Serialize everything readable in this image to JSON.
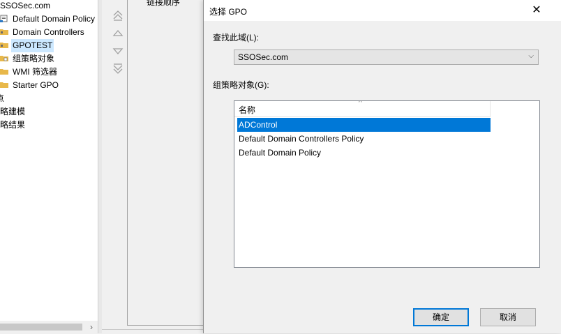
{
  "tree": {
    "items": [
      {
        "label": "SSOSec.com",
        "icon": "domain-icon",
        "indent": false
      },
      {
        "label": "Default Domain Policy",
        "icon": "gpo-link-icon",
        "indent": true
      },
      {
        "label": "Domain Controllers",
        "icon": "ou-folder-icon",
        "indent": true
      },
      {
        "label": "GPOTEST",
        "icon": "ou-folder-icon",
        "indent": true,
        "selected": true
      },
      {
        "label": "组策略对象",
        "icon": "folder-icon",
        "indent": true
      },
      {
        "label": "WMI 筛选器",
        "icon": "folder-icon",
        "indent": true
      },
      {
        "label": "Starter GPO",
        "icon": "folder-icon",
        "indent": true
      },
      {
        "label": "点",
        "icon": "",
        "indent": false
      },
      {
        "label": "策略建模",
        "icon": "",
        "indent": false
      },
      {
        "label": "策略结果",
        "icon": "",
        "indent": false
      }
    ]
  },
  "middle": {
    "column_header": "链接顺序"
  },
  "dialog": {
    "title": "选择 GPO",
    "close_glyph": "✕",
    "domain_label": "查找此域(L):",
    "domain_value": "SSOSec.com",
    "gpo_label": "组策略对象(G):",
    "list_header": "名称",
    "rows": [
      "ADControl",
      "Default Domain Controllers Policy",
      "Default Domain Policy"
    ],
    "selected_index": 0,
    "ok_label": "确定",
    "cancel_label": "取消"
  },
  "colors": {
    "selection": "#0078d7",
    "tree_selection": "#cce8ff",
    "folder": "#e8b84a"
  }
}
